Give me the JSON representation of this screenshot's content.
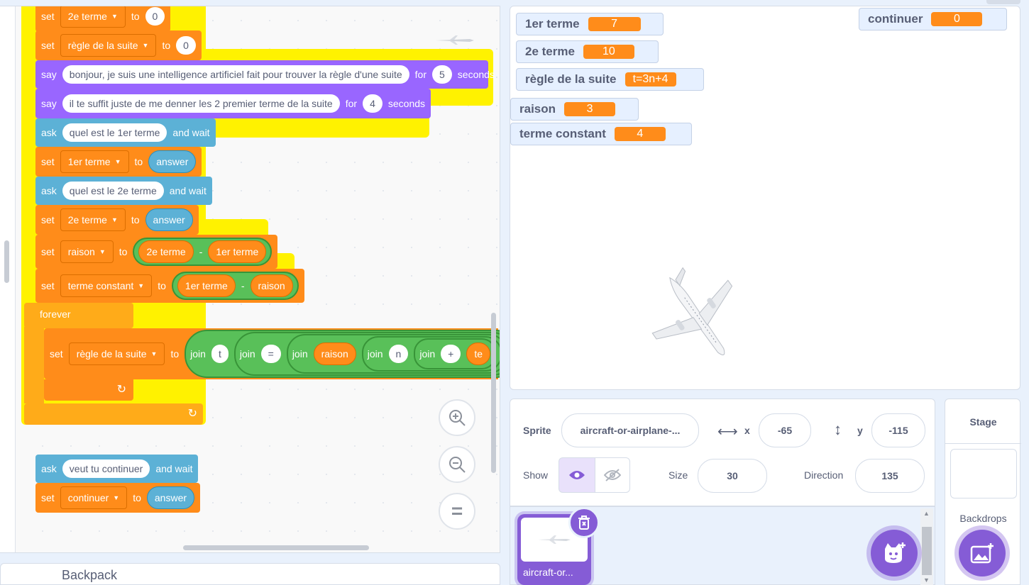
{
  "code": {
    "blocks": {
      "set_2e_terme_0": {
        "set": "set",
        "var": "2e terme",
        "to": "to",
        "value": "0"
      },
      "set_regle_0": {
        "set": "set",
        "var": "règle de la suite",
        "to": "to",
        "value": "0"
      },
      "say1": {
        "say": "say",
        "text": "bonjour, je suis une intelligence artificiel fait pour trouver la règle d'une suite",
        "for": "for",
        "secs": "5",
        "seconds": "seconds"
      },
      "say2": {
        "say": "say",
        "text": "il te suffit juste de me denner les 2 premier terme de la suite",
        "for": "for",
        "secs": "4",
        "seconds": "seconds"
      },
      "ask1": {
        "ask": "ask",
        "text": "quel est le 1er terme",
        "wait": "and wait"
      },
      "set_1er": {
        "set": "set",
        "var": "1er terme",
        "to": "to",
        "value": "answer"
      },
      "ask2": {
        "ask": "ask",
        "text": "quel est le 2e terme",
        "wait": "and wait"
      },
      "set_2e": {
        "set": "set",
        "var": "2e terme",
        "to": "to",
        "value": "answer"
      },
      "set_raison": {
        "set": "set",
        "var": "raison",
        "to": "to",
        "a": "2e terme",
        "minus": "-",
        "b": "1er terme"
      },
      "set_const": {
        "set": "set",
        "var": "terme constant",
        "to": "to",
        "a": "1er terme",
        "minus": "-",
        "b": "raison"
      },
      "forever": "forever",
      "set_regle_join": {
        "set": "set",
        "var": "règle de la suite",
        "to": "to",
        "join": "join",
        "t": "t",
        "eq": "=",
        "raison": "raison",
        "n": "n",
        "plus": "+",
        "te": "te"
      },
      "ask3": {
        "ask": "ask",
        "text": "veut tu continuer",
        "wait": "and wait"
      },
      "set_cont": {
        "set": "set",
        "var": "continuer",
        "to": "to",
        "value": "answer"
      }
    },
    "zoom_reset": "="
  },
  "backpack": {
    "label": "Backpack"
  },
  "stage": {
    "monitors": {
      "m1": {
        "name": "1er terme",
        "value": "7"
      },
      "m2": {
        "name": "2e terme",
        "value": "10"
      },
      "m3": {
        "name": "règle de la suite",
        "value": "t=3n+4"
      },
      "m4": {
        "name": "raison",
        "value": "3"
      },
      "m5": {
        "name": "terme constant",
        "value": "4"
      },
      "m6": {
        "name": "continuer",
        "value": "0"
      }
    }
  },
  "sprite_info": {
    "sprite_label": "Sprite",
    "sprite_name": "aircraft-or-airplane-...",
    "x_label": "x",
    "x_value": "-65",
    "y_label": "y",
    "y_value": "-115",
    "show_label": "Show",
    "size_label": "Size",
    "size_value": "30",
    "direction_label": "Direction",
    "direction_value": "135"
  },
  "sprite_list": {
    "sprite_thumb_name": "aircraft-or..."
  },
  "stage_panel": {
    "title": "Stage",
    "backdrops_label": "Backdrops"
  },
  "colors": {
    "motion_orange": "#ff8c1a",
    "looks_purple": "#9966ff",
    "sensing_blue": "#5cb1d6",
    "operator_green": "#59c059",
    "control_yellow": "#ffab19",
    "highlight": "#fff200",
    "ui_purple": "#855cd6"
  }
}
